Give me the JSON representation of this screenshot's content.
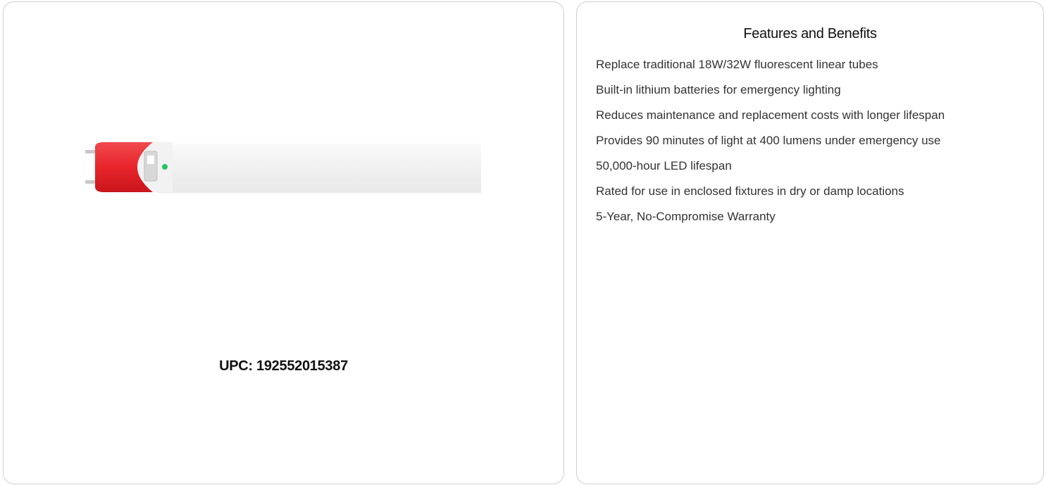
{
  "product": {
    "upc_text": "UPC: 192552015387",
    "image_icon": "led-tube-icon",
    "colors": {
      "endcap_red": "#e8252b",
      "tube_white": "#f5f5f5",
      "indicator_green": "#22c55e"
    }
  },
  "features": {
    "title": "Features and Benefits",
    "items": [
      "Replace traditional 18W/32W fluorescent linear tubes",
      "Built-in lithium batteries for emergency lighting",
      "Reduces maintenance and replacement costs with longer lifespan",
      "Provides 90 minutes of light at 400 lumens under emergency use",
      "50,000-hour LED lifespan",
      "Rated for use in enclosed fixtures in dry or damp locations",
      "5-Year, No-Compromise Warranty"
    ]
  }
}
